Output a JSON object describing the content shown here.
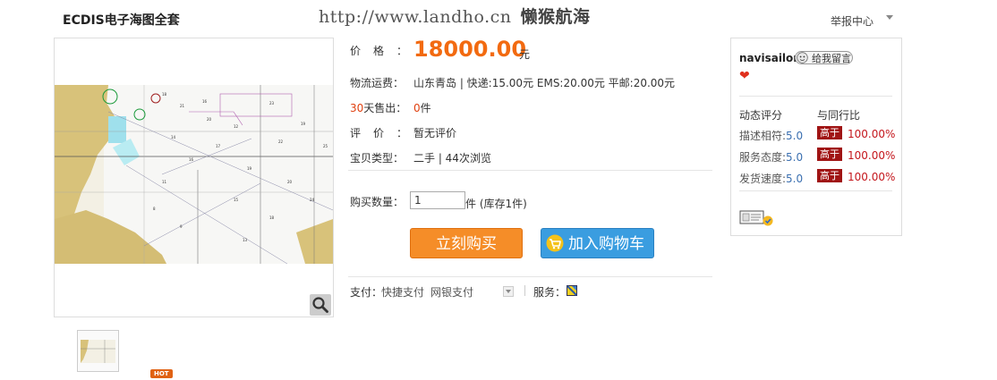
{
  "header": {
    "title": "ECDIS电子海图全套",
    "watermark_url": "http://www.landho.cn",
    "watermark_name": "懒猴航海",
    "report_link": "举报中心"
  },
  "gallery": {
    "thumbnail_badge": "HOT"
  },
  "details": {
    "price_label": "价格：",
    "price_value": "18000.00",
    "price_unit": "元",
    "shipping_label": "物流运费：",
    "shipping_value": "山东青岛 | 快递:15.00元 EMS:20.00元 平邮:20.00元",
    "sold_label_num": "30",
    "sold_label_text": "天售出：",
    "sold_count": "0",
    "sold_unit": "件",
    "review_label": "评价：",
    "review_value": "暂无评价",
    "type_label": "宝贝类型：",
    "type_value": "二手 | 44次浏览",
    "qty_label": "购买数量：",
    "qty_value": "1",
    "qty_note": "件 (库存1件)",
    "buy_button": "立刻购买",
    "cart_button": "加入购物车",
    "pay_label": "支付：",
    "pay_option_1": "快捷支付",
    "pay_option_2": "网银支付",
    "service_label": "服务："
  },
  "seller": {
    "name": "navisailor",
    "message_button": "给我留言",
    "dynamic_rating_label": "动态评分",
    "compare_label": "与同行比",
    "ratings": [
      {
        "label": "描述相符:",
        "score": "5.0",
        "badge": "高于",
        "percent": "100.00%"
      },
      {
        "label": "服务态度:",
        "score": "5.0",
        "badge": "高于",
        "percent": "100.00%"
      },
      {
        "label": "发货速度:",
        "score": "5.0",
        "badge": "高于",
        "percent": "100.00%"
      }
    ]
  },
  "colors": {
    "price": "#f26a10",
    "buy_button": "#f58d28",
    "cart_button": "#3a9de0",
    "high_badge": "#a01414"
  },
  "icons": [
    "magnifier-icon",
    "cart-icon",
    "message-icon",
    "heart-icon",
    "service-icon",
    "certification-icon",
    "dropdown-arrow-icon"
  ]
}
